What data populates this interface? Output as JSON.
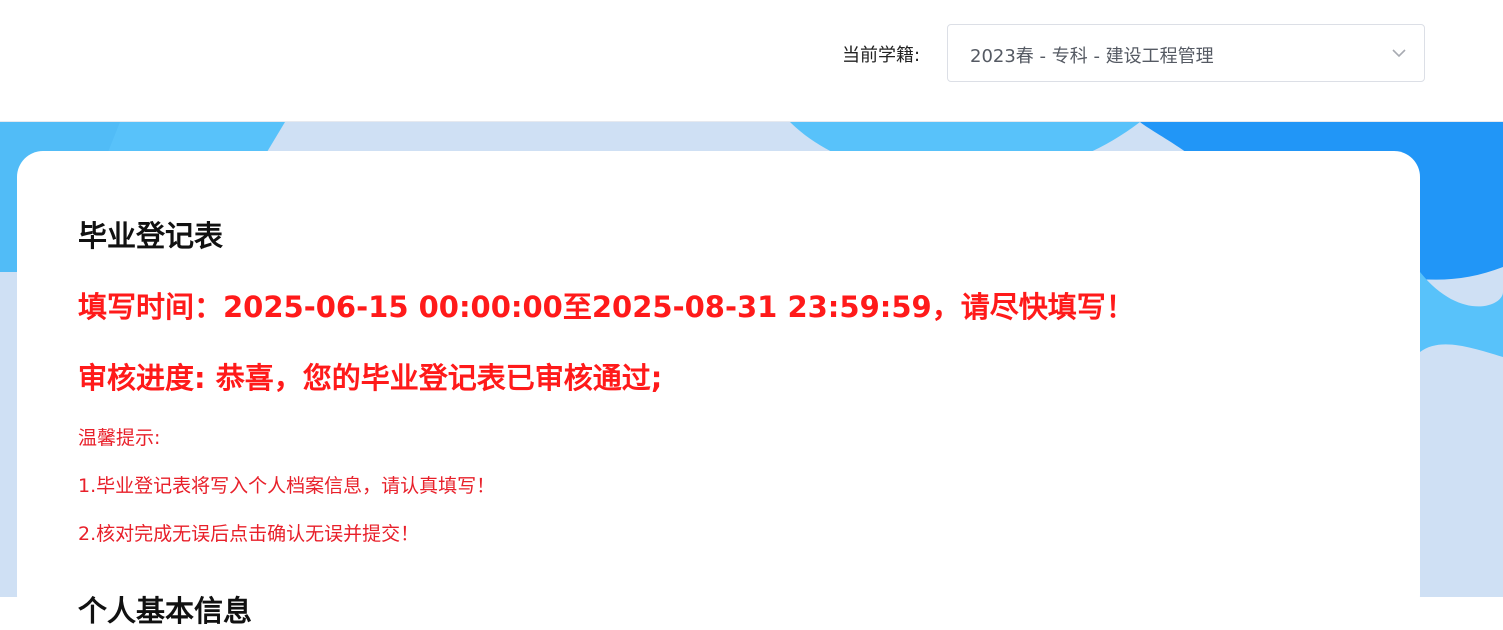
{
  "header": {
    "enrollment_label": "当前学籍:",
    "enrollment_value": "2023春 - 专科 - 建设工程管理"
  },
  "card": {
    "title": "毕业登记表",
    "deadline": "填写时间：2025-06-15 00:00:00至2025-08-31 23:59:59，请尽快填写！",
    "progress": "审核进度: 恭喜，您的毕业登记表已审核通过;",
    "tips": {
      "heading": "温馨提示:",
      "items": [
        "1.毕业登记表将写入个人档案信息，请认真填写！",
        "2.核对完成无误后点击确认无误并提交！"
      ]
    },
    "next_section": "个人基本信息"
  },
  "colors": {
    "alert_red": "#ff1a1a",
    "tip_red": "#e8202a",
    "banner_light": "#cfe0f4",
    "banner_sky": "#58c2fa",
    "banner_blue": "#2196f7"
  },
  "icons": {
    "select_arrow": "chevron-down-icon"
  }
}
